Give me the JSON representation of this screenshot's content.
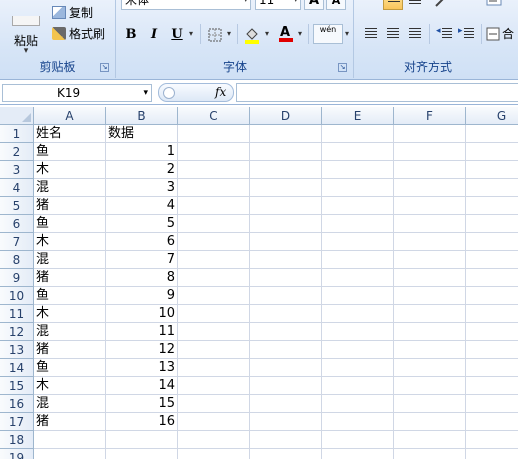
{
  "ribbon": {
    "clipboard": {
      "paste_label": "粘贴",
      "copy_label": "复制",
      "format_painter_label": "格式刷",
      "group_label": "剪贴板"
    },
    "font": {
      "font_name": "宋体",
      "font_size": "11",
      "bold": "B",
      "italic": "I",
      "underline": "U",
      "font_color_glyph": "A",
      "phonetic_glyph": "wén",
      "grow_glyph": "A",
      "shrink_glyph": "A",
      "group_label": "字体"
    },
    "alignment": {
      "group_label": "对齐方式",
      "merge_label": "合"
    }
  },
  "formula_bar": {
    "name_box": "K19",
    "fx_label": "fx",
    "formula": ""
  },
  "sheet": {
    "columns": [
      "A",
      "B",
      "C",
      "D",
      "E",
      "F",
      "G"
    ],
    "rows": [
      {
        "num": "1",
        "a": "姓名",
        "b": "数据"
      },
      {
        "num": "2",
        "a": "鱼",
        "b": "1"
      },
      {
        "num": "3",
        "a": "木",
        "b": "2"
      },
      {
        "num": "4",
        "a": "混",
        "b": "3"
      },
      {
        "num": "5",
        "a": "猪",
        "b": "4"
      },
      {
        "num": "6",
        "a": "鱼",
        "b": "5"
      },
      {
        "num": "7",
        "a": "木",
        "b": "6"
      },
      {
        "num": "8",
        "a": "混",
        "b": "7"
      },
      {
        "num": "9",
        "a": "猪",
        "b": "8"
      },
      {
        "num": "10",
        "a": "鱼",
        "b": "9"
      },
      {
        "num": "11",
        "a": "木",
        "b": "10"
      },
      {
        "num": "12",
        "a": "混",
        "b": "11"
      },
      {
        "num": "13",
        "a": "猪",
        "b": "12"
      },
      {
        "num": "14",
        "a": "鱼",
        "b": "13"
      },
      {
        "num": "15",
        "a": "木",
        "b": "14"
      },
      {
        "num": "16",
        "a": "混",
        "b": "15"
      },
      {
        "num": "17",
        "a": "猪",
        "b": "16"
      },
      {
        "num": "18",
        "a": "",
        "b": ""
      },
      {
        "num": "19",
        "a": "",
        "b": ""
      }
    ]
  }
}
